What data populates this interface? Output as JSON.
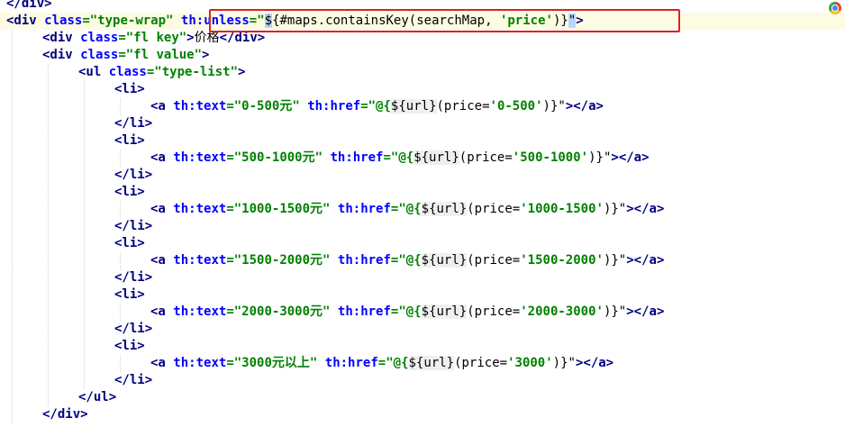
{
  "editor": {
    "lines": [
      {
        "indent": 0,
        "tokens": [
          {
            "t": "tag",
            "s": "</div>"
          }
        ]
      },
      {
        "indent": 0,
        "highlighted": true,
        "tokens": [
          {
            "t": "tag",
            "s": "<div "
          },
          {
            "t": "attr",
            "s": "class"
          },
          {
            "t": "val",
            "s": "=\"type-wrap\""
          },
          {
            "t": "txt",
            "s": " "
          },
          {
            "t": "attr",
            "s": "th:unless"
          },
          {
            "t": "val",
            "s": "=\""
          },
          {
            "t": "sel",
            "s": "$"
          },
          {
            "t": "txt",
            "s": "{#maps.containsKey(searchMap, "
          },
          {
            "t": "val",
            "s": "'price'"
          },
          {
            "t": "txt",
            "s": ")}"
          },
          {
            "t": "sel",
            "s": "\""
          },
          {
            "t": "tag",
            "s": ">"
          }
        ]
      },
      {
        "indent": 1,
        "tokens": [
          {
            "t": "tag",
            "s": "<div "
          },
          {
            "t": "attr",
            "s": "class"
          },
          {
            "t": "val",
            "s": "=\"fl key\""
          },
          {
            "t": "tag",
            "s": ">"
          },
          {
            "t": "txt",
            "s": "价格"
          },
          {
            "t": "tag",
            "s": "</div>"
          }
        ]
      },
      {
        "indent": 1,
        "tokens": [
          {
            "t": "tag",
            "s": "<div "
          },
          {
            "t": "attr",
            "s": "class"
          },
          {
            "t": "val",
            "s": "=\"fl value\""
          },
          {
            "t": "tag",
            "s": ">"
          }
        ]
      },
      {
        "indent": 2,
        "tokens": [
          {
            "t": "tag",
            "s": "<ul "
          },
          {
            "t": "attr",
            "s": "class"
          },
          {
            "t": "val",
            "s": "=\"type-list\""
          },
          {
            "t": "tag",
            "s": ">"
          }
        ]
      },
      {
        "indent": 3,
        "tokens": [
          {
            "t": "tag",
            "s": "<li>"
          }
        ]
      },
      {
        "indent": 4,
        "tokens": [
          {
            "t": "tag",
            "s": "<a "
          },
          {
            "t": "attr",
            "s": "th:text"
          },
          {
            "t": "val",
            "s": "=\"0-500元\""
          },
          {
            "t": "txt",
            "s": " "
          },
          {
            "t": "attr",
            "s": "th:href"
          },
          {
            "t": "val",
            "s": "=\"@{"
          },
          {
            "t": "gray",
            "s": "${url}"
          },
          {
            "t": "txt",
            "s": "(price="
          },
          {
            "t": "val",
            "s": "'0-500'"
          },
          {
            "t": "txt",
            "s": ")}\""
          },
          {
            "t": "tag",
            "s": "></a>"
          }
        ]
      },
      {
        "indent": 3,
        "tokens": [
          {
            "t": "tag",
            "s": "</li>"
          }
        ]
      },
      {
        "indent": 3,
        "tokens": [
          {
            "t": "tag",
            "s": "<li>"
          }
        ]
      },
      {
        "indent": 4,
        "tokens": [
          {
            "t": "tag",
            "s": "<a "
          },
          {
            "t": "attr",
            "s": "th:text"
          },
          {
            "t": "val",
            "s": "=\"500-1000元\""
          },
          {
            "t": "txt",
            "s": " "
          },
          {
            "t": "attr",
            "s": "th:href"
          },
          {
            "t": "val",
            "s": "=\"@{"
          },
          {
            "t": "gray",
            "s": "${url}"
          },
          {
            "t": "txt",
            "s": "(price="
          },
          {
            "t": "val",
            "s": "'500-1000'"
          },
          {
            "t": "txt",
            "s": ")}\""
          },
          {
            "t": "tag",
            "s": "></a>"
          }
        ]
      },
      {
        "indent": 3,
        "tokens": [
          {
            "t": "tag",
            "s": "</li>"
          }
        ]
      },
      {
        "indent": 3,
        "tokens": [
          {
            "t": "tag",
            "s": "<li>"
          }
        ]
      },
      {
        "indent": 4,
        "tokens": [
          {
            "t": "tag",
            "s": "<a "
          },
          {
            "t": "attr",
            "s": "th:text"
          },
          {
            "t": "val",
            "s": "=\"1000-1500元\""
          },
          {
            "t": "txt",
            "s": " "
          },
          {
            "t": "attr",
            "s": "th:href"
          },
          {
            "t": "val",
            "s": "=\"@{"
          },
          {
            "t": "gray",
            "s": "${url}"
          },
          {
            "t": "txt",
            "s": "(price="
          },
          {
            "t": "val",
            "s": "'1000-1500'"
          },
          {
            "t": "txt",
            "s": ")}\""
          },
          {
            "t": "tag",
            "s": "></a>"
          }
        ]
      },
      {
        "indent": 3,
        "tokens": [
          {
            "t": "tag",
            "s": "</li>"
          }
        ]
      },
      {
        "indent": 3,
        "tokens": [
          {
            "t": "tag",
            "s": "<li>"
          }
        ]
      },
      {
        "indent": 4,
        "tokens": [
          {
            "t": "tag",
            "s": "<a "
          },
          {
            "t": "attr",
            "s": "th:text"
          },
          {
            "t": "val",
            "s": "=\"1500-2000元\""
          },
          {
            "t": "txt",
            "s": " "
          },
          {
            "t": "attr",
            "s": "th:href"
          },
          {
            "t": "val",
            "s": "=\"@{"
          },
          {
            "t": "gray",
            "s": "${url}"
          },
          {
            "t": "txt",
            "s": "(price="
          },
          {
            "t": "val",
            "s": "'1500-2000'"
          },
          {
            "t": "txt",
            "s": ")}\""
          },
          {
            "t": "tag",
            "s": "></a>"
          }
        ]
      },
      {
        "indent": 3,
        "tokens": [
          {
            "t": "tag",
            "s": "</li>"
          }
        ]
      },
      {
        "indent": 3,
        "tokens": [
          {
            "t": "tag",
            "s": "<li>"
          }
        ]
      },
      {
        "indent": 4,
        "tokens": [
          {
            "t": "tag",
            "s": "<a "
          },
          {
            "t": "attr",
            "s": "th:text"
          },
          {
            "t": "val",
            "s": "=\"2000-3000元\""
          },
          {
            "t": "txt",
            "s": " "
          },
          {
            "t": "attr",
            "s": "th:href"
          },
          {
            "t": "val",
            "s": "=\"@{"
          },
          {
            "t": "gray",
            "s": "${url}"
          },
          {
            "t": "txt",
            "s": "(price="
          },
          {
            "t": "val",
            "s": "'2000-3000'"
          },
          {
            "t": "txt",
            "s": ")}\""
          },
          {
            "t": "tag",
            "s": "></a>"
          }
        ]
      },
      {
        "indent": 3,
        "tokens": [
          {
            "t": "tag",
            "s": "</li>"
          }
        ]
      },
      {
        "indent": 3,
        "tokens": [
          {
            "t": "tag",
            "s": "<li>"
          }
        ]
      },
      {
        "indent": 4,
        "tokens": [
          {
            "t": "tag",
            "s": "<a "
          },
          {
            "t": "attr",
            "s": "th:text"
          },
          {
            "t": "val",
            "s": "=\"3000元以上\""
          },
          {
            "t": "txt",
            "s": " "
          },
          {
            "t": "attr",
            "s": "th:href"
          },
          {
            "t": "val",
            "s": "=\"@{"
          },
          {
            "t": "gray",
            "s": "${url}"
          },
          {
            "t": "txt",
            "s": "(price="
          },
          {
            "t": "val",
            "s": "'3000'"
          },
          {
            "t": "txt",
            "s": ")}\""
          },
          {
            "t": "tag",
            "s": "></a>"
          }
        ]
      },
      {
        "indent": 3,
        "tokens": [
          {
            "t": "tag",
            "s": "</li>"
          }
        ]
      },
      {
        "indent": 2,
        "tokens": [
          {
            "t": "tag",
            "s": "</ul>"
          }
        ]
      },
      {
        "indent": 1,
        "tokens": [
          {
            "t": "tag",
            "s": "</div>"
          }
        ]
      }
    ]
  },
  "annotation": {
    "color": "#e02020"
  },
  "browser_icon": {
    "name": "chrome-icon"
  }
}
